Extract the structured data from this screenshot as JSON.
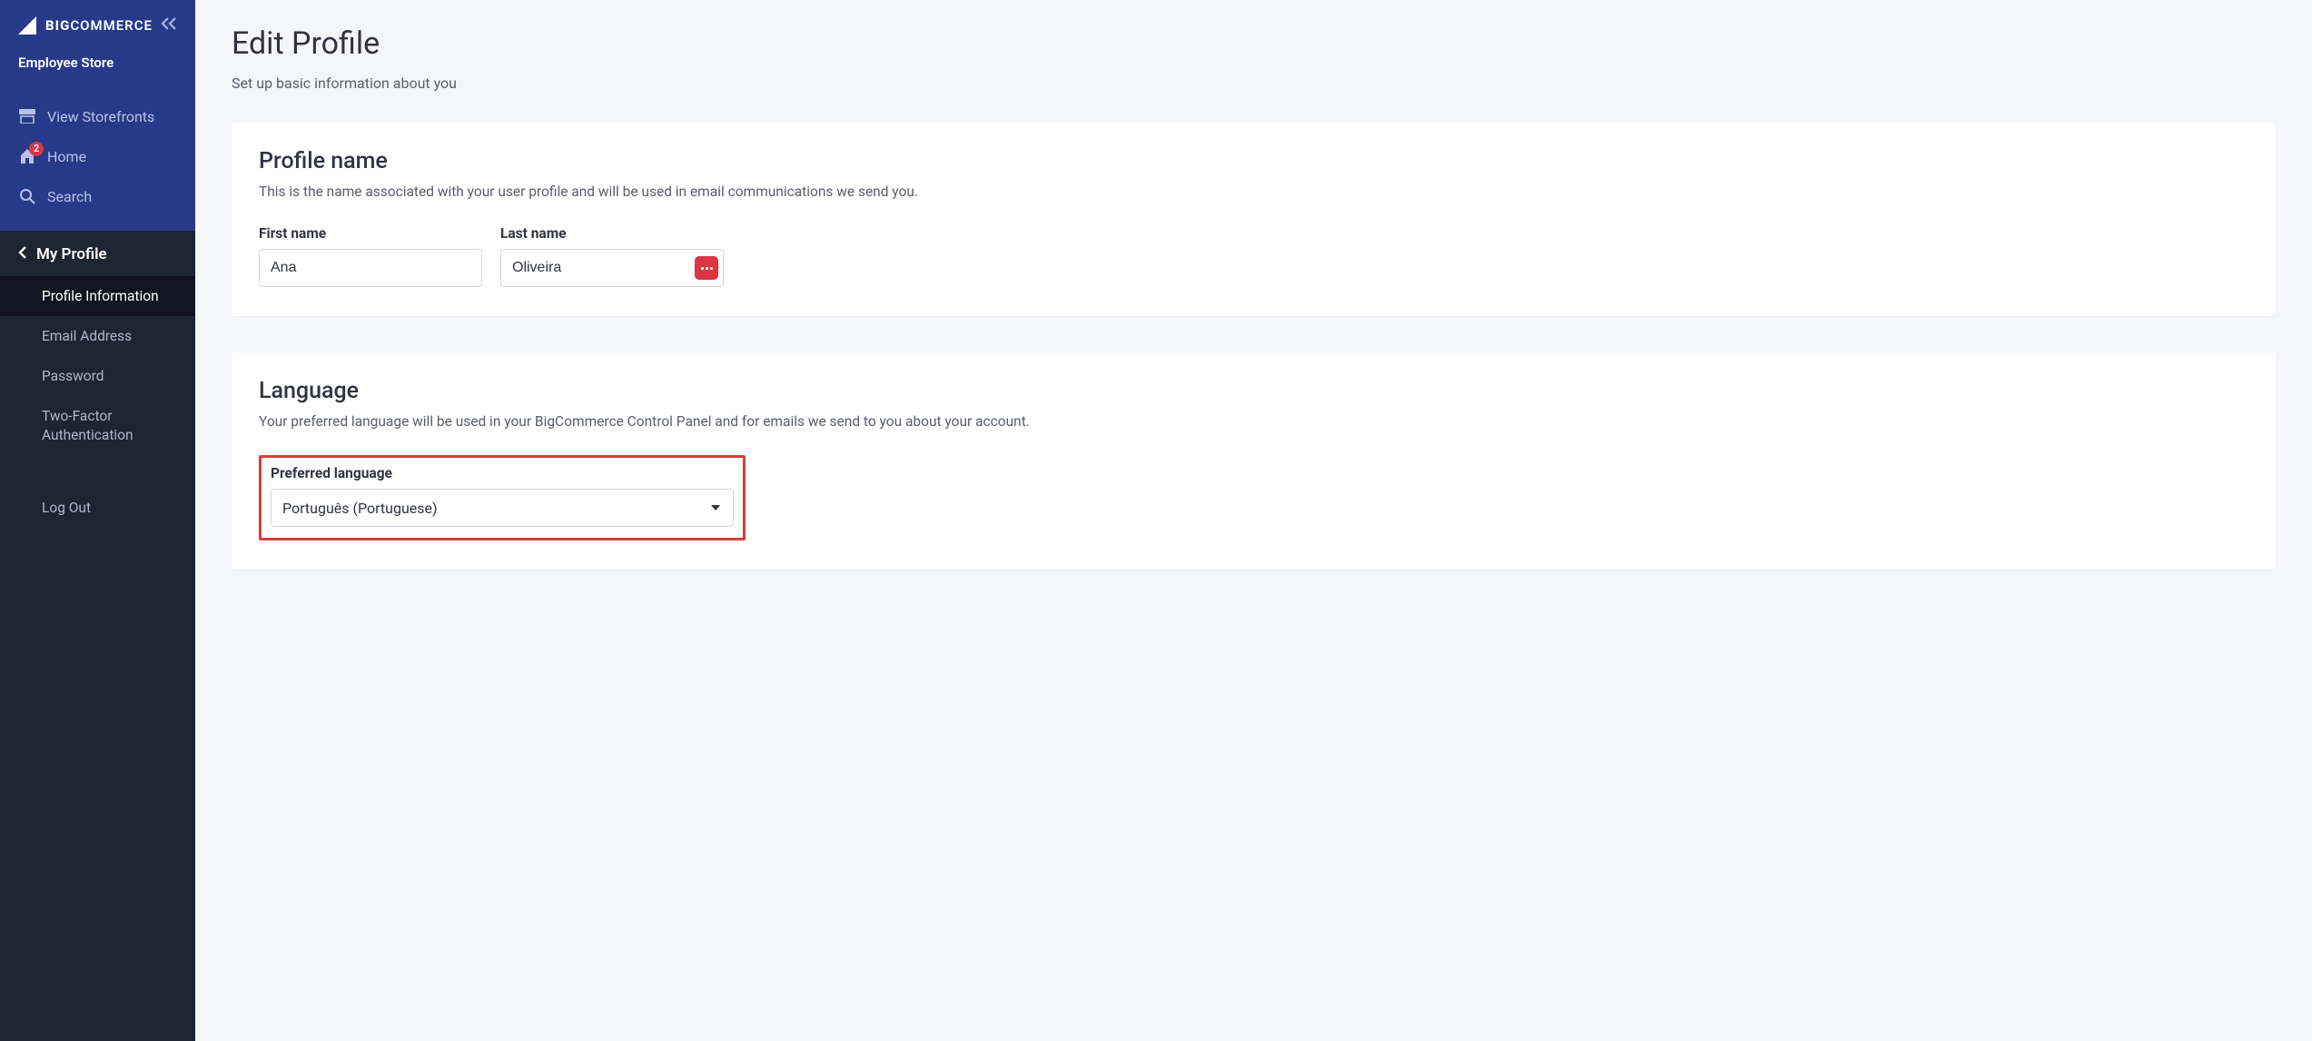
{
  "brand": {
    "name_strong": "BIG",
    "name_rest": "COMMERCE"
  },
  "store_name": "Employee Store",
  "nav": {
    "view_storefronts": "View Storefronts",
    "home": "Home",
    "home_badge": "2",
    "search": "Search"
  },
  "profile_nav": {
    "header": "My Profile",
    "items": [
      {
        "label": "Profile Information",
        "active": true
      },
      {
        "label": "Email Address",
        "active": false
      },
      {
        "label": "Password",
        "active": false
      },
      {
        "label": "Two-Factor Authentication",
        "active": false
      }
    ],
    "logout": "Log Out"
  },
  "page": {
    "title": "Edit Profile",
    "subtitle": "Set up basic information about you"
  },
  "profile_name": {
    "section_title": "Profile name",
    "desc": "This is the name associated with your user profile and will be used in email communications we send you.",
    "first_name_label": "First name",
    "first_name_value": "Ana",
    "last_name_label": "Last name",
    "last_name_value": "Oliveira"
  },
  "language": {
    "section_title": "Language",
    "desc": "Your preferred language will be used in your BigCommerce Control Panel and for emails we send to you about your account.",
    "preferred_label": "Preferred language",
    "preferred_value": "Português (Portuguese)"
  }
}
